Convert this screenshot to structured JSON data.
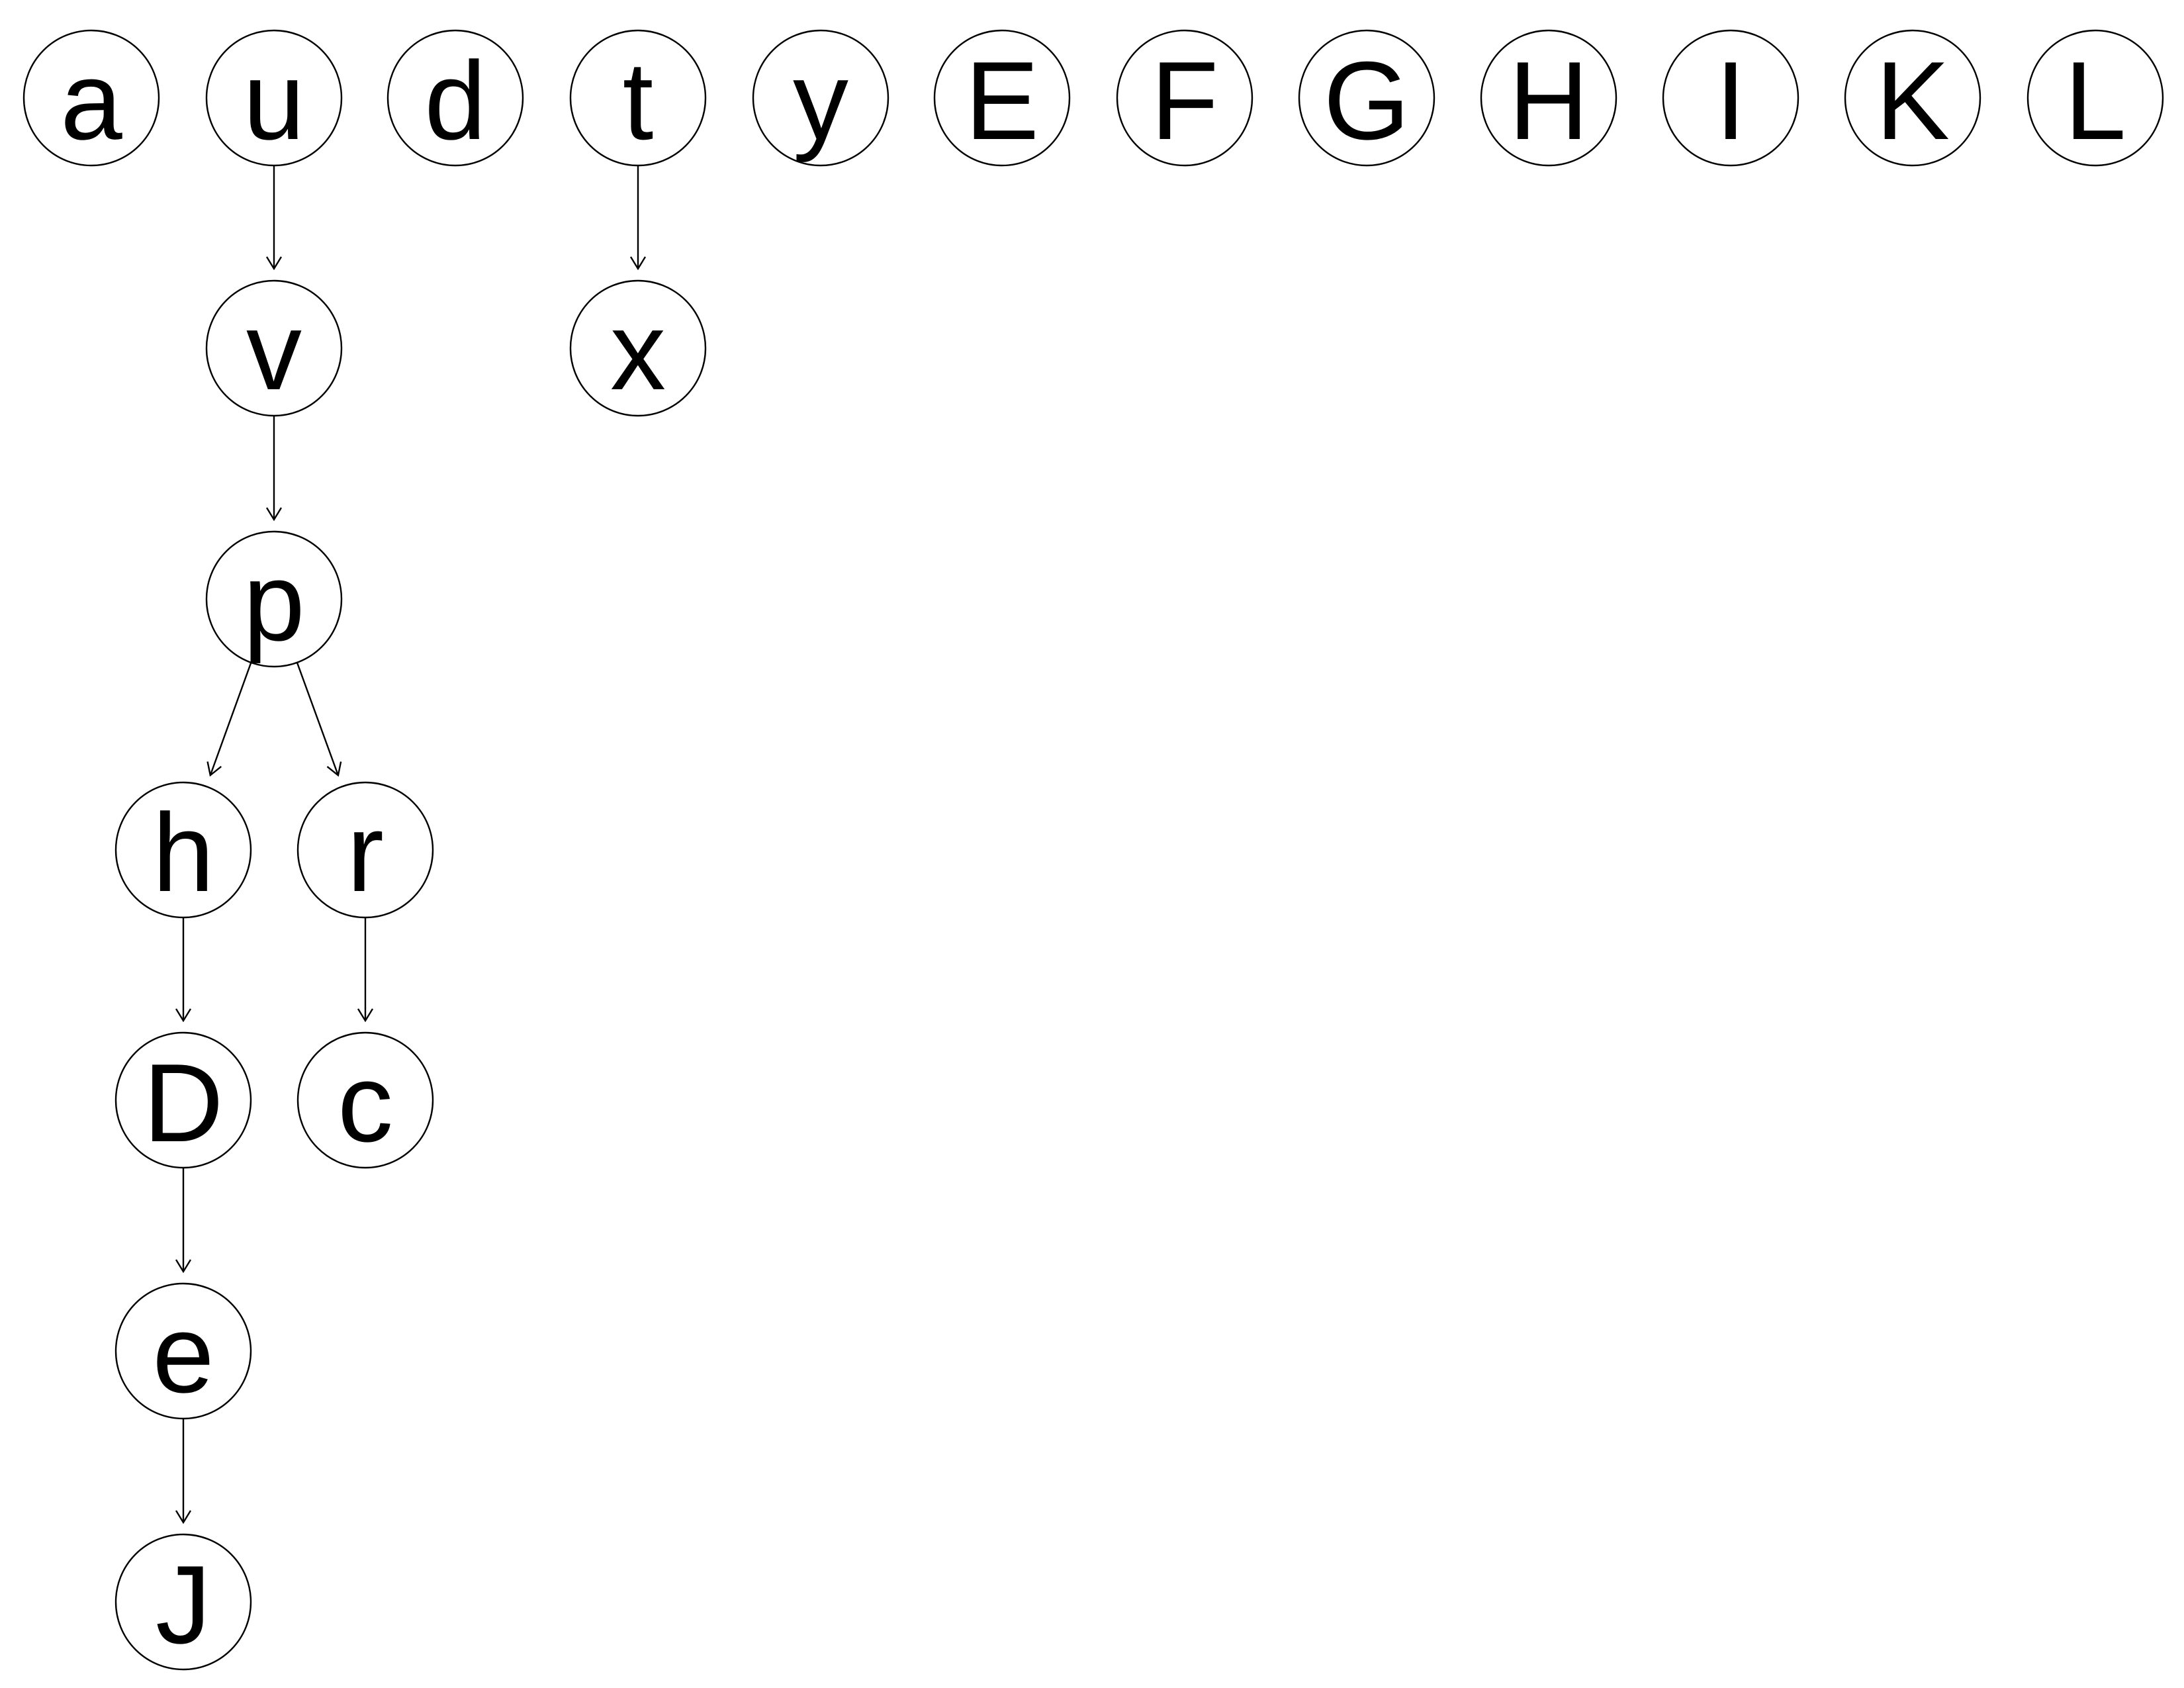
{
  "diagram": {
    "type": "tree",
    "nodes": [
      {
        "id": "a",
        "label": "a"
      },
      {
        "id": "u",
        "label": "u"
      },
      {
        "id": "d",
        "label": "d"
      },
      {
        "id": "t",
        "label": "t"
      },
      {
        "id": "y",
        "label": "y"
      },
      {
        "id": "E",
        "label": "E"
      },
      {
        "id": "F",
        "label": "F"
      },
      {
        "id": "G",
        "label": "G"
      },
      {
        "id": "H",
        "label": "H"
      },
      {
        "id": "I",
        "label": "I"
      },
      {
        "id": "K",
        "label": "K"
      },
      {
        "id": "L",
        "label": "L"
      },
      {
        "id": "v",
        "label": "v"
      },
      {
        "id": "x",
        "label": "x"
      },
      {
        "id": "p",
        "label": "p"
      },
      {
        "id": "h",
        "label": "h"
      },
      {
        "id": "r",
        "label": "r"
      },
      {
        "id": "D",
        "label": "D"
      },
      {
        "id": "c",
        "label": "c"
      },
      {
        "id": "e",
        "label": "e"
      },
      {
        "id": "J",
        "label": "J"
      }
    ],
    "edges": [
      {
        "from": "u",
        "to": "v"
      },
      {
        "from": "t",
        "to": "x"
      },
      {
        "from": "v",
        "to": "p"
      },
      {
        "from": "p",
        "to": "h"
      },
      {
        "from": "p",
        "to": "r"
      },
      {
        "from": "h",
        "to": "D"
      },
      {
        "from": "r",
        "to": "c"
      },
      {
        "from": "D",
        "to": "e"
      },
      {
        "from": "e",
        "to": "J"
      }
    ]
  }
}
